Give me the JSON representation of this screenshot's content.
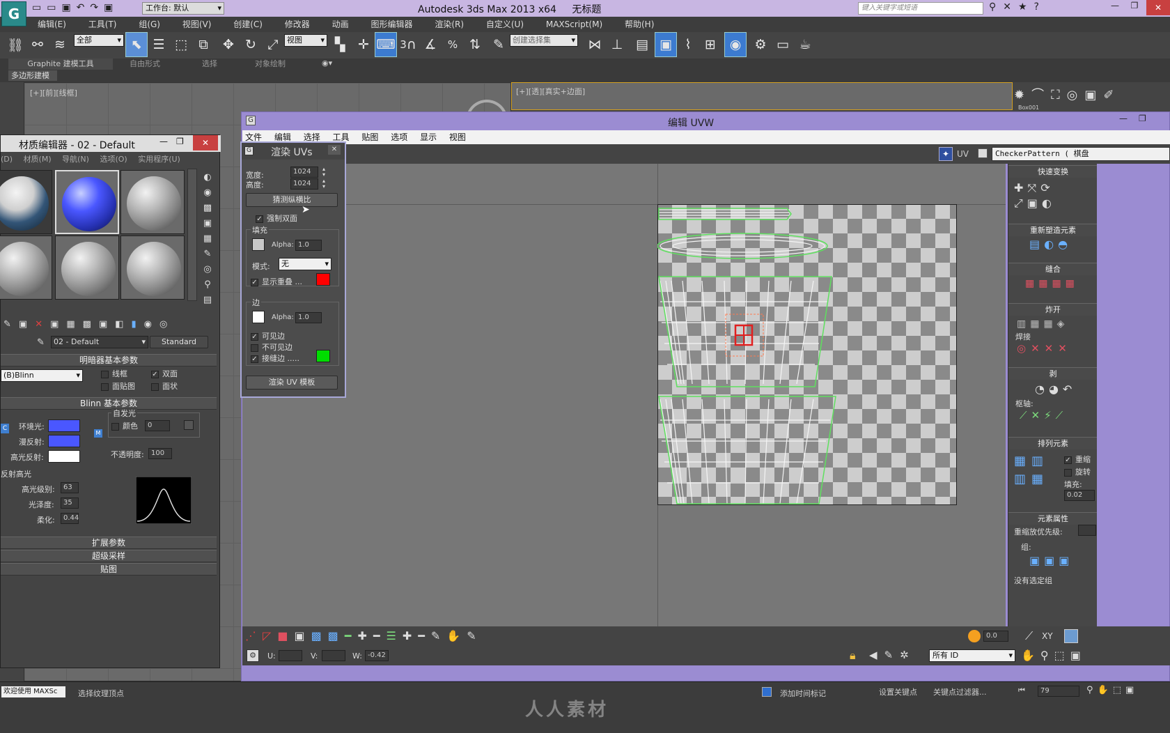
{
  "app": {
    "title": "Autodesk 3ds Max 2013 x64",
    "doc_title": "无标题",
    "workspace": "工作台: 默认",
    "search_placeholder": "键入关键字或短语"
  },
  "main_menu": [
    "编辑(E)",
    "工具(T)",
    "组(G)",
    "视图(V)",
    "创建(C)",
    "修改器",
    "动画",
    "图形编辑器",
    "渲染(R)",
    "自定义(U)",
    "MAXScript(M)",
    "帮助(H)"
  ],
  "toolbar": {
    "filter_value": "全部",
    "view_value": "视图",
    "selection_set_placeholder": "创建选择集",
    "snap_label": "3",
    "percent_label": "%"
  },
  "ribbon": {
    "tabs": [
      "Graphite 建模工具",
      "自由形式",
      "选择",
      "对象绘制"
    ],
    "sub_tab": "多边形建模"
  },
  "viewports": {
    "left_label": "[+][前][线框]",
    "right_label": "[+][透][真实+边面]",
    "box_label": "Box001"
  },
  "material_editor": {
    "title": "材质编辑器 - 02 - Default",
    "menu": [
      "(D)",
      "材质(M)",
      "导航(N)",
      "选项(O)",
      "实用程序(U)"
    ],
    "material_name": "02 - Default",
    "material_type": "Standard",
    "shader_rollout": "明暗器基本参数",
    "shader_value": "(B)Blinn",
    "wire": "线框",
    "two_sided": "双面",
    "face_map": "面贴图",
    "faceted": "面状",
    "blinn_rollout": "Blinn 基本参数",
    "self_illum": "自发光",
    "color_label": "颜色",
    "color_value": "0",
    "ambient": "环境光:",
    "diffuse": "漫反射:",
    "specular": "高光反射:",
    "opacity_label": "不透明度:",
    "opacity_value": "100",
    "spec_highlights": "反射高光",
    "spec_level_label": "高光级别:",
    "spec_level": "63",
    "glossiness_label": "光泽度:",
    "glossiness": "35",
    "soften_label": "柔化:",
    "soften": "0.44",
    "ambient_letter": "C",
    "map_letter": "M",
    "rollouts": [
      "扩展参数",
      "超级采样",
      "贴图"
    ]
  },
  "uvw_editor": {
    "title": "编辑 UVW",
    "menu": [
      "文件",
      "编辑",
      "选择",
      "工具",
      "贴图",
      "选项",
      "显示",
      "视图"
    ],
    "uv_label": "UV",
    "texture": "CheckerPattern ( 棋盘",
    "bottom": {
      "u_label": "U:",
      "v_label": "V:",
      "w_label": "W:",
      "w_value": "-0.42",
      "zoom": "0.0",
      "xy": "XY",
      "all_ids": "所有 ID"
    }
  },
  "render_uvs": {
    "title": "渲染 UVs",
    "width_label": "宽度:",
    "width": "1024",
    "height_label": "高度:",
    "height": "1024",
    "guess_aspect": "猜测纵横比",
    "force_2sided": "强制双面",
    "fill_group": "填充",
    "alpha_label": "Alpha:",
    "fill_alpha": "1.0",
    "mode_label": "模式:",
    "mode_value": "无",
    "show_overlap": "显示重叠 ...",
    "edge_group": "边",
    "edge_alpha": "1.0",
    "visible_edges": "可见边",
    "invisible_edges": "不可见边",
    "seam_edges": "接缝边 .....",
    "render_button": "渲染 UV 模板",
    "overlap_color": "#ff0000",
    "seam_color": "#00dd00"
  },
  "right_panel": {
    "quick_transform": "快速变换",
    "reshape": "重新塑造元素",
    "stitch": "缝合",
    "explode": "炸开",
    "weld": "焊接",
    "peel": "剥",
    "pivot": "枢轴:",
    "arrange": "排列元素",
    "rescale": "重缩",
    "rotate": "旋转",
    "padding_label": "填充:",
    "padding": "0.02",
    "element_props": "元素属性",
    "rescale_priority": "重缩放优先级:",
    "group": "组:",
    "no_selection": "没有选定组"
  },
  "status": {
    "welcome": "欢迎使用 MAXSc",
    "prompt": "选择纹理顶点",
    "add_time_tag": "添加时间标记",
    "set_key": "设置关键点",
    "key_filters": "关键点过滤器...",
    "frame": "79"
  },
  "watermark": "人人素材",
  "colors": {
    "titlebar": "#c8b6e2",
    "purple_frame": "#9b8cd2",
    "ambient": "#4a57ff",
    "accent_blue": "#2f6fd0"
  }
}
